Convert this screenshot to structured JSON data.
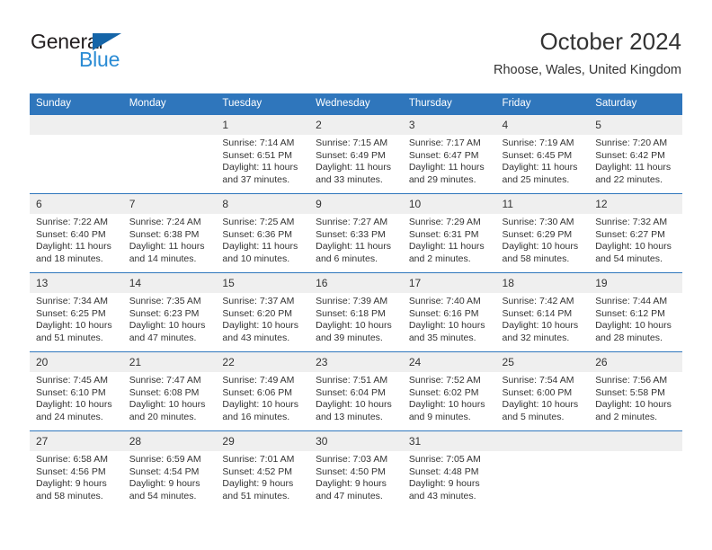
{
  "brand": {
    "name_part1": "General",
    "name_part2": "Blue",
    "triangle_color": "#1565a8",
    "blue_color": "#2a8bd4"
  },
  "header": {
    "title": "October 2024",
    "subtitle": "Rhoose, Wales, United Kingdom",
    "header_bg": "#2f76bc",
    "daynum_bg": "#efefef"
  },
  "weekdays": [
    "Sunday",
    "Monday",
    "Tuesday",
    "Wednesday",
    "Thursday",
    "Friday",
    "Saturday"
  ],
  "labels": {
    "sunrise": "Sunrise:",
    "sunset": "Sunset:",
    "daylight": "Daylight:"
  },
  "weeks": [
    [
      {
        "day": "",
        "sunrise": "",
        "sunset": "",
        "daylight": ""
      },
      {
        "day": "",
        "sunrise": "",
        "sunset": "",
        "daylight": ""
      },
      {
        "day": "1",
        "sunrise": "Sunrise: 7:14 AM",
        "sunset": "Sunset: 6:51 PM",
        "daylight": "Daylight: 11 hours and 37 minutes."
      },
      {
        "day": "2",
        "sunrise": "Sunrise: 7:15 AM",
        "sunset": "Sunset: 6:49 PM",
        "daylight": "Daylight: 11 hours and 33 minutes."
      },
      {
        "day": "3",
        "sunrise": "Sunrise: 7:17 AM",
        "sunset": "Sunset: 6:47 PM",
        "daylight": "Daylight: 11 hours and 29 minutes."
      },
      {
        "day": "4",
        "sunrise": "Sunrise: 7:19 AM",
        "sunset": "Sunset: 6:45 PM",
        "daylight": "Daylight: 11 hours and 25 minutes."
      },
      {
        "day": "5",
        "sunrise": "Sunrise: 7:20 AM",
        "sunset": "Sunset: 6:42 PM",
        "daylight": "Daylight: 11 hours and 22 minutes."
      }
    ],
    [
      {
        "day": "6",
        "sunrise": "Sunrise: 7:22 AM",
        "sunset": "Sunset: 6:40 PM",
        "daylight": "Daylight: 11 hours and 18 minutes."
      },
      {
        "day": "7",
        "sunrise": "Sunrise: 7:24 AM",
        "sunset": "Sunset: 6:38 PM",
        "daylight": "Daylight: 11 hours and 14 minutes."
      },
      {
        "day": "8",
        "sunrise": "Sunrise: 7:25 AM",
        "sunset": "Sunset: 6:36 PM",
        "daylight": "Daylight: 11 hours and 10 minutes."
      },
      {
        "day": "9",
        "sunrise": "Sunrise: 7:27 AM",
        "sunset": "Sunset: 6:33 PM",
        "daylight": "Daylight: 11 hours and 6 minutes."
      },
      {
        "day": "10",
        "sunrise": "Sunrise: 7:29 AM",
        "sunset": "Sunset: 6:31 PM",
        "daylight": "Daylight: 11 hours and 2 minutes."
      },
      {
        "day": "11",
        "sunrise": "Sunrise: 7:30 AM",
        "sunset": "Sunset: 6:29 PM",
        "daylight": "Daylight: 10 hours and 58 minutes."
      },
      {
        "day": "12",
        "sunrise": "Sunrise: 7:32 AM",
        "sunset": "Sunset: 6:27 PM",
        "daylight": "Daylight: 10 hours and 54 minutes."
      }
    ],
    [
      {
        "day": "13",
        "sunrise": "Sunrise: 7:34 AM",
        "sunset": "Sunset: 6:25 PM",
        "daylight": "Daylight: 10 hours and 51 minutes."
      },
      {
        "day": "14",
        "sunrise": "Sunrise: 7:35 AM",
        "sunset": "Sunset: 6:23 PM",
        "daylight": "Daylight: 10 hours and 47 minutes."
      },
      {
        "day": "15",
        "sunrise": "Sunrise: 7:37 AM",
        "sunset": "Sunset: 6:20 PM",
        "daylight": "Daylight: 10 hours and 43 minutes."
      },
      {
        "day": "16",
        "sunrise": "Sunrise: 7:39 AM",
        "sunset": "Sunset: 6:18 PM",
        "daylight": "Daylight: 10 hours and 39 minutes."
      },
      {
        "day": "17",
        "sunrise": "Sunrise: 7:40 AM",
        "sunset": "Sunset: 6:16 PM",
        "daylight": "Daylight: 10 hours and 35 minutes."
      },
      {
        "day": "18",
        "sunrise": "Sunrise: 7:42 AM",
        "sunset": "Sunset: 6:14 PM",
        "daylight": "Daylight: 10 hours and 32 minutes."
      },
      {
        "day": "19",
        "sunrise": "Sunrise: 7:44 AM",
        "sunset": "Sunset: 6:12 PM",
        "daylight": "Daylight: 10 hours and 28 minutes."
      }
    ],
    [
      {
        "day": "20",
        "sunrise": "Sunrise: 7:45 AM",
        "sunset": "Sunset: 6:10 PM",
        "daylight": "Daylight: 10 hours and 24 minutes."
      },
      {
        "day": "21",
        "sunrise": "Sunrise: 7:47 AM",
        "sunset": "Sunset: 6:08 PM",
        "daylight": "Daylight: 10 hours and 20 minutes."
      },
      {
        "day": "22",
        "sunrise": "Sunrise: 7:49 AM",
        "sunset": "Sunset: 6:06 PM",
        "daylight": "Daylight: 10 hours and 16 minutes."
      },
      {
        "day": "23",
        "sunrise": "Sunrise: 7:51 AM",
        "sunset": "Sunset: 6:04 PM",
        "daylight": "Daylight: 10 hours and 13 minutes."
      },
      {
        "day": "24",
        "sunrise": "Sunrise: 7:52 AM",
        "sunset": "Sunset: 6:02 PM",
        "daylight": "Daylight: 10 hours and 9 minutes."
      },
      {
        "day": "25",
        "sunrise": "Sunrise: 7:54 AM",
        "sunset": "Sunset: 6:00 PM",
        "daylight": "Daylight: 10 hours and 5 minutes."
      },
      {
        "day": "26",
        "sunrise": "Sunrise: 7:56 AM",
        "sunset": "Sunset: 5:58 PM",
        "daylight": "Daylight: 10 hours and 2 minutes."
      }
    ],
    [
      {
        "day": "27",
        "sunrise": "Sunrise: 6:58 AM",
        "sunset": "Sunset: 4:56 PM",
        "daylight": "Daylight: 9 hours and 58 minutes."
      },
      {
        "day": "28",
        "sunrise": "Sunrise: 6:59 AM",
        "sunset": "Sunset: 4:54 PM",
        "daylight": "Daylight: 9 hours and 54 minutes."
      },
      {
        "day": "29",
        "sunrise": "Sunrise: 7:01 AM",
        "sunset": "Sunset: 4:52 PM",
        "daylight": "Daylight: 9 hours and 51 minutes."
      },
      {
        "day": "30",
        "sunrise": "Sunrise: 7:03 AM",
        "sunset": "Sunset: 4:50 PM",
        "daylight": "Daylight: 9 hours and 47 minutes."
      },
      {
        "day": "31",
        "sunrise": "Sunrise: 7:05 AM",
        "sunset": "Sunset: 4:48 PM",
        "daylight": "Daylight: 9 hours and 43 minutes."
      },
      {
        "day": "",
        "sunrise": "",
        "sunset": "",
        "daylight": ""
      },
      {
        "day": "",
        "sunrise": "",
        "sunset": "",
        "daylight": ""
      }
    ]
  ]
}
